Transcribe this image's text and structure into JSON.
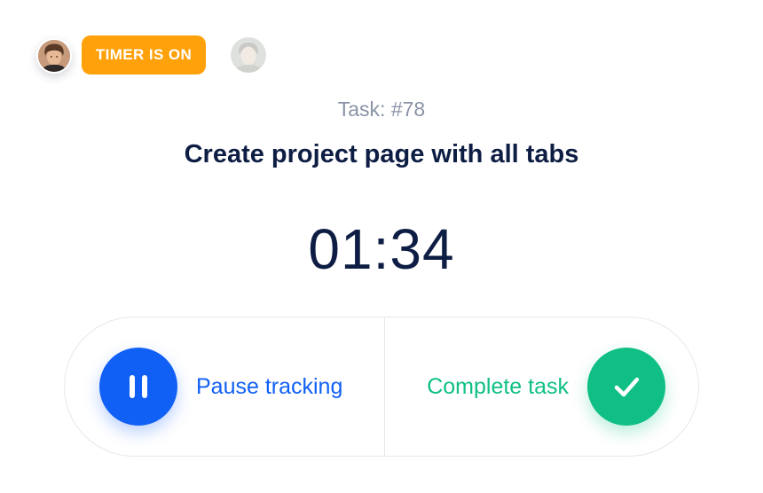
{
  "header": {
    "status_badge": "TIMER IS ON",
    "current_user_avatar": "user-avatar",
    "other_user_avatar": "user-avatar"
  },
  "task": {
    "number_label": "Task: #78",
    "title": "Create project page with all tabs"
  },
  "timer": {
    "elapsed": "01:34"
  },
  "controls": {
    "pause_label": "Pause tracking",
    "pause_icon": "pause-icon",
    "complete_label": "Complete task",
    "complete_icon": "check-icon"
  },
  "colors": {
    "badge": "#ffa10a",
    "pause": "#1160f5",
    "complete": "#0fbf85",
    "title": "#0d1d43",
    "muted": "#8a93a6"
  }
}
